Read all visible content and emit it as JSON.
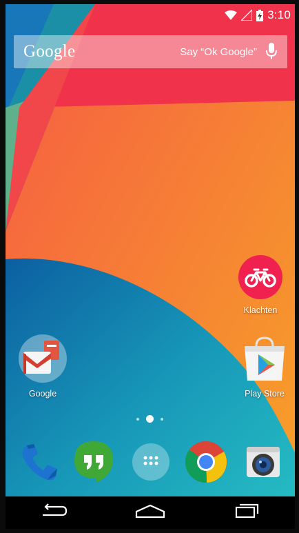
{
  "status_bar": {
    "time": "3:10",
    "icons": [
      "wifi-icon",
      "signal-icon",
      "battery-charging-icon"
    ]
  },
  "search": {
    "logo": "Google",
    "hint": "Say “Ok Google”",
    "icon": "mic-icon"
  },
  "home_apps": [
    {
      "label": "Klachten",
      "icon": "bicycle-icon",
      "color": "#f0204f"
    },
    {
      "label": "Google",
      "icon": "google-folder-icon"
    },
    {
      "label": "Play Store",
      "icon": "play-store-icon"
    }
  ],
  "page_indicator": {
    "pages": 3,
    "active": 2
  },
  "dock": [
    {
      "name": "Phone",
      "icon": "phone-icon"
    },
    {
      "name": "Hangouts",
      "icon": "hangouts-icon"
    },
    {
      "name": "Apps",
      "icon": "app-drawer-icon"
    },
    {
      "name": "Chrome",
      "icon": "chrome-icon"
    },
    {
      "name": "Camera",
      "icon": "camera-icon"
    }
  ],
  "nav_bar": {
    "buttons": [
      "back-icon",
      "home-icon",
      "recents-icon"
    ]
  },
  "colors": {
    "wallpaper_orange": "#f27a35",
    "wallpaper_red": "#f0334a",
    "wallpaper_teal": "#1fb4c1",
    "accent_pink": "#f0204f"
  }
}
